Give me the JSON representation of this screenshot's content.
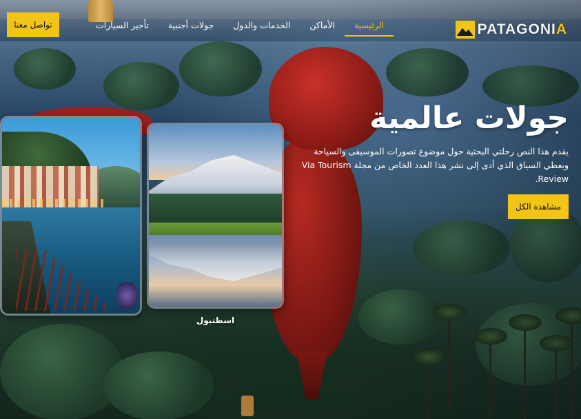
{
  "header": {
    "logo_text_main": "PATAGONI",
    "logo_text_accent": "A",
    "nav": [
      {
        "label": "الرئيسية",
        "active": true
      },
      {
        "label": "الأماكن",
        "active": false
      },
      {
        "label": "الخدمات والدول",
        "active": false
      },
      {
        "label": "جولات أجنبية",
        "active": false
      },
      {
        "label": "تأجير السيارات",
        "active": false
      }
    ],
    "contact_label": "تواصل معنا"
  },
  "hero": {
    "title": "جولات عالمية",
    "description": "يقدم هذا النص رحلتي البحثية حول موضوع تصورات الموسيقى والسياحة ويعطي السياق الذي أدى إلى نشر هذا العدد الخاص من مجلة Via Tourism Review.",
    "view_all_label": "مشاهدة الكل"
  },
  "cards": [
    {
      "caption": ""
    },
    {
      "caption": "اسطنبول"
    }
  ],
  "colors": {
    "accent": "#f2c417",
    "text": "#ffffff"
  }
}
